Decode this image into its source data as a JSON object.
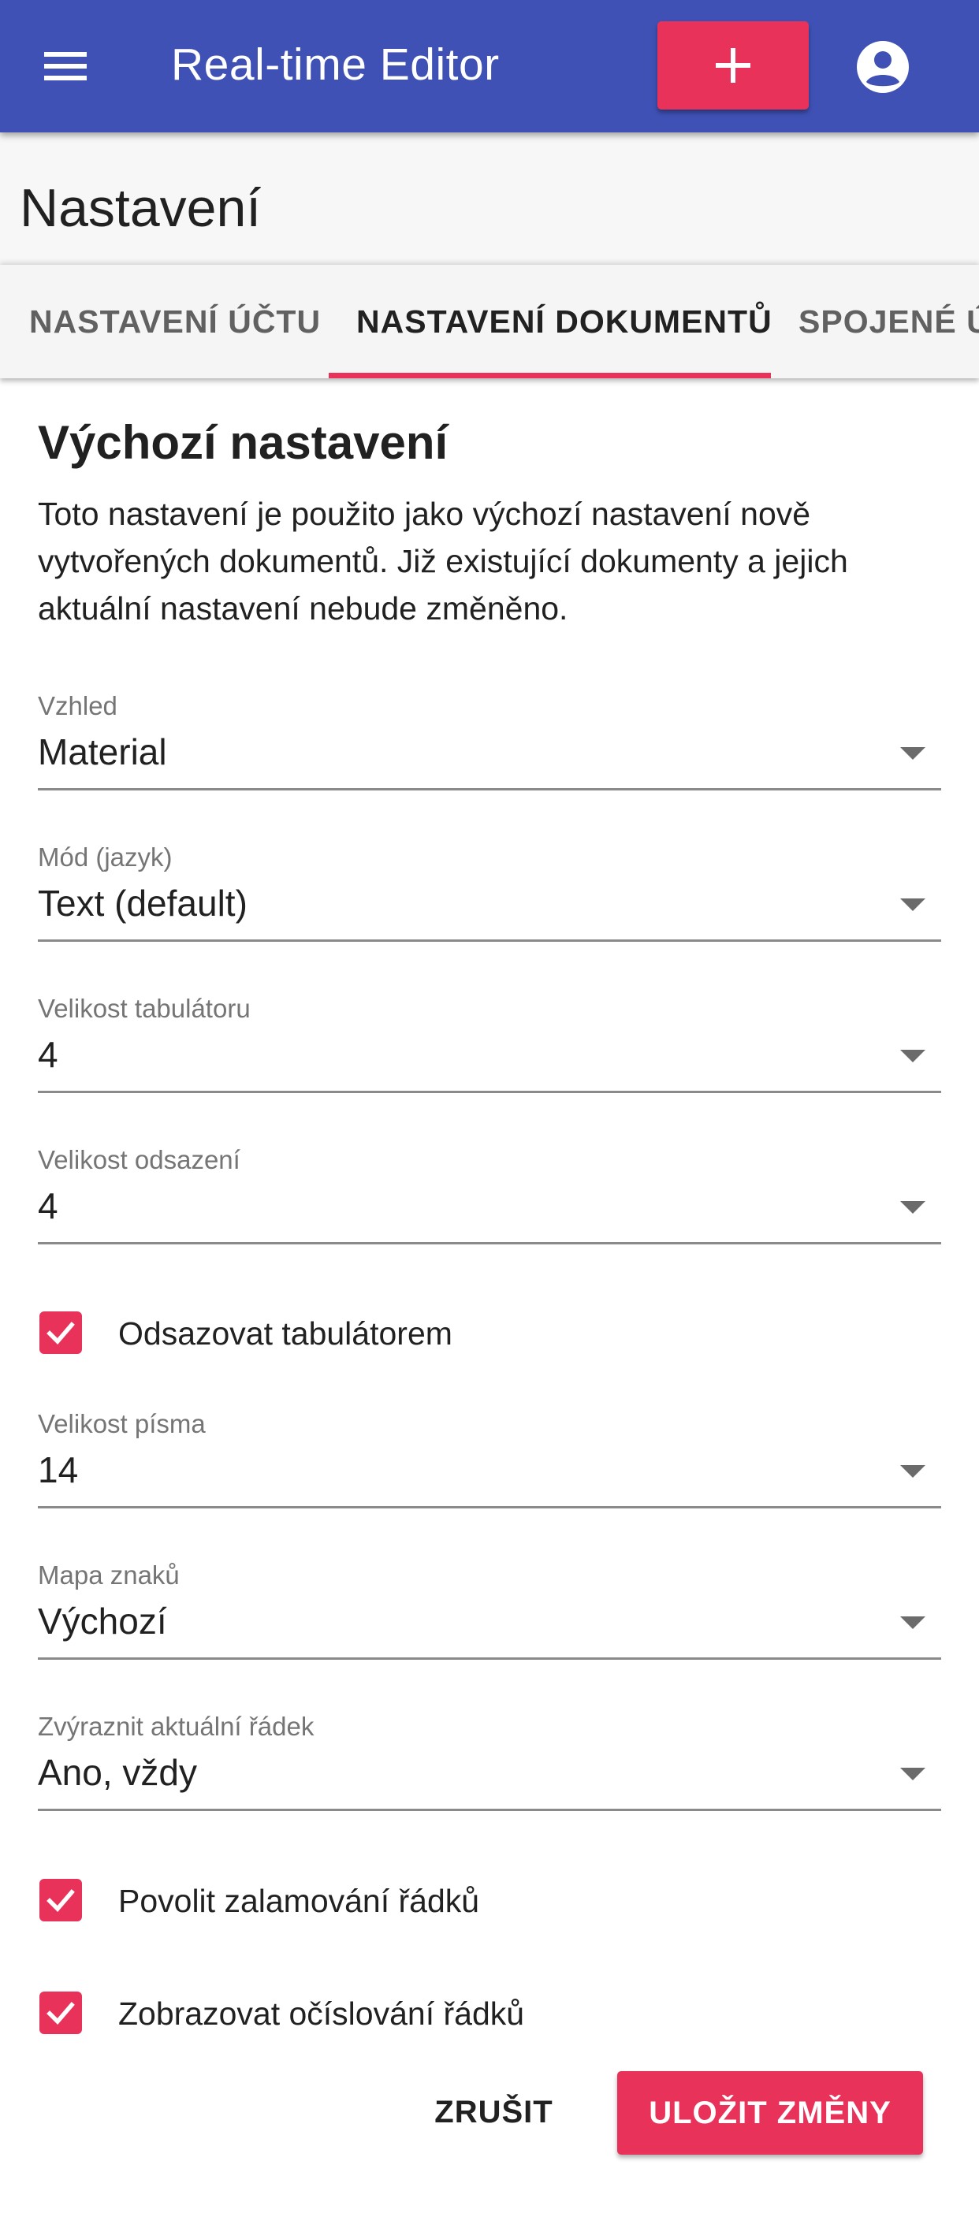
{
  "appbar": {
    "title": "Real-time Editor",
    "menu_icon": "menu-icon",
    "add_icon": "plus-icon",
    "account_icon": "account-circle-icon",
    "color": "#3f51b5",
    "accent": "#e8325a"
  },
  "page": {
    "title": "Nastavení"
  },
  "tabs": [
    {
      "label": "NASTAVENÍ ÚČTU",
      "active": false
    },
    {
      "label": "NASTAVENÍ DOKUMENTŮ",
      "active": true
    },
    {
      "label": "SPOJENÉ ÚČ",
      "active": false
    }
  ],
  "section": {
    "title": "Výchozí nastavení",
    "description": "Toto nastavení je použito jako výchozí nastavení nově vytvořených dokumentů. Již existující dokumenty a jejich aktuální nastavení nebude změněno."
  },
  "fields": {
    "theme": {
      "label": "Vzhled",
      "value": "Material"
    },
    "mode": {
      "label": "Mód (jazyk)",
      "value": "Text (default)"
    },
    "tab_size": {
      "label": "Velikost tabulátoru",
      "value": "4"
    },
    "indent_size": {
      "label": "Velikost odsazení",
      "value": "4"
    },
    "font_size": {
      "label": "Velikost písma",
      "value": "14"
    },
    "keymap": {
      "label": "Mapa znaků",
      "value": "Výchozí"
    },
    "highlight_line": {
      "label": "Zvýraznit aktuální řádek",
      "value": "Ano, vždy"
    }
  },
  "checkboxes": {
    "indent_with_tabs": {
      "label": "Odsazovat tabulátorem",
      "checked": true
    },
    "line_wrap": {
      "label": "Povolit zalamování řádků",
      "checked": true
    },
    "line_numbers": {
      "label": "Zobrazovat očíslování řádků",
      "checked": true
    }
  },
  "actions": {
    "cancel": "ZRUŠIT",
    "save": "ULOŽIT ZMĚNY"
  }
}
